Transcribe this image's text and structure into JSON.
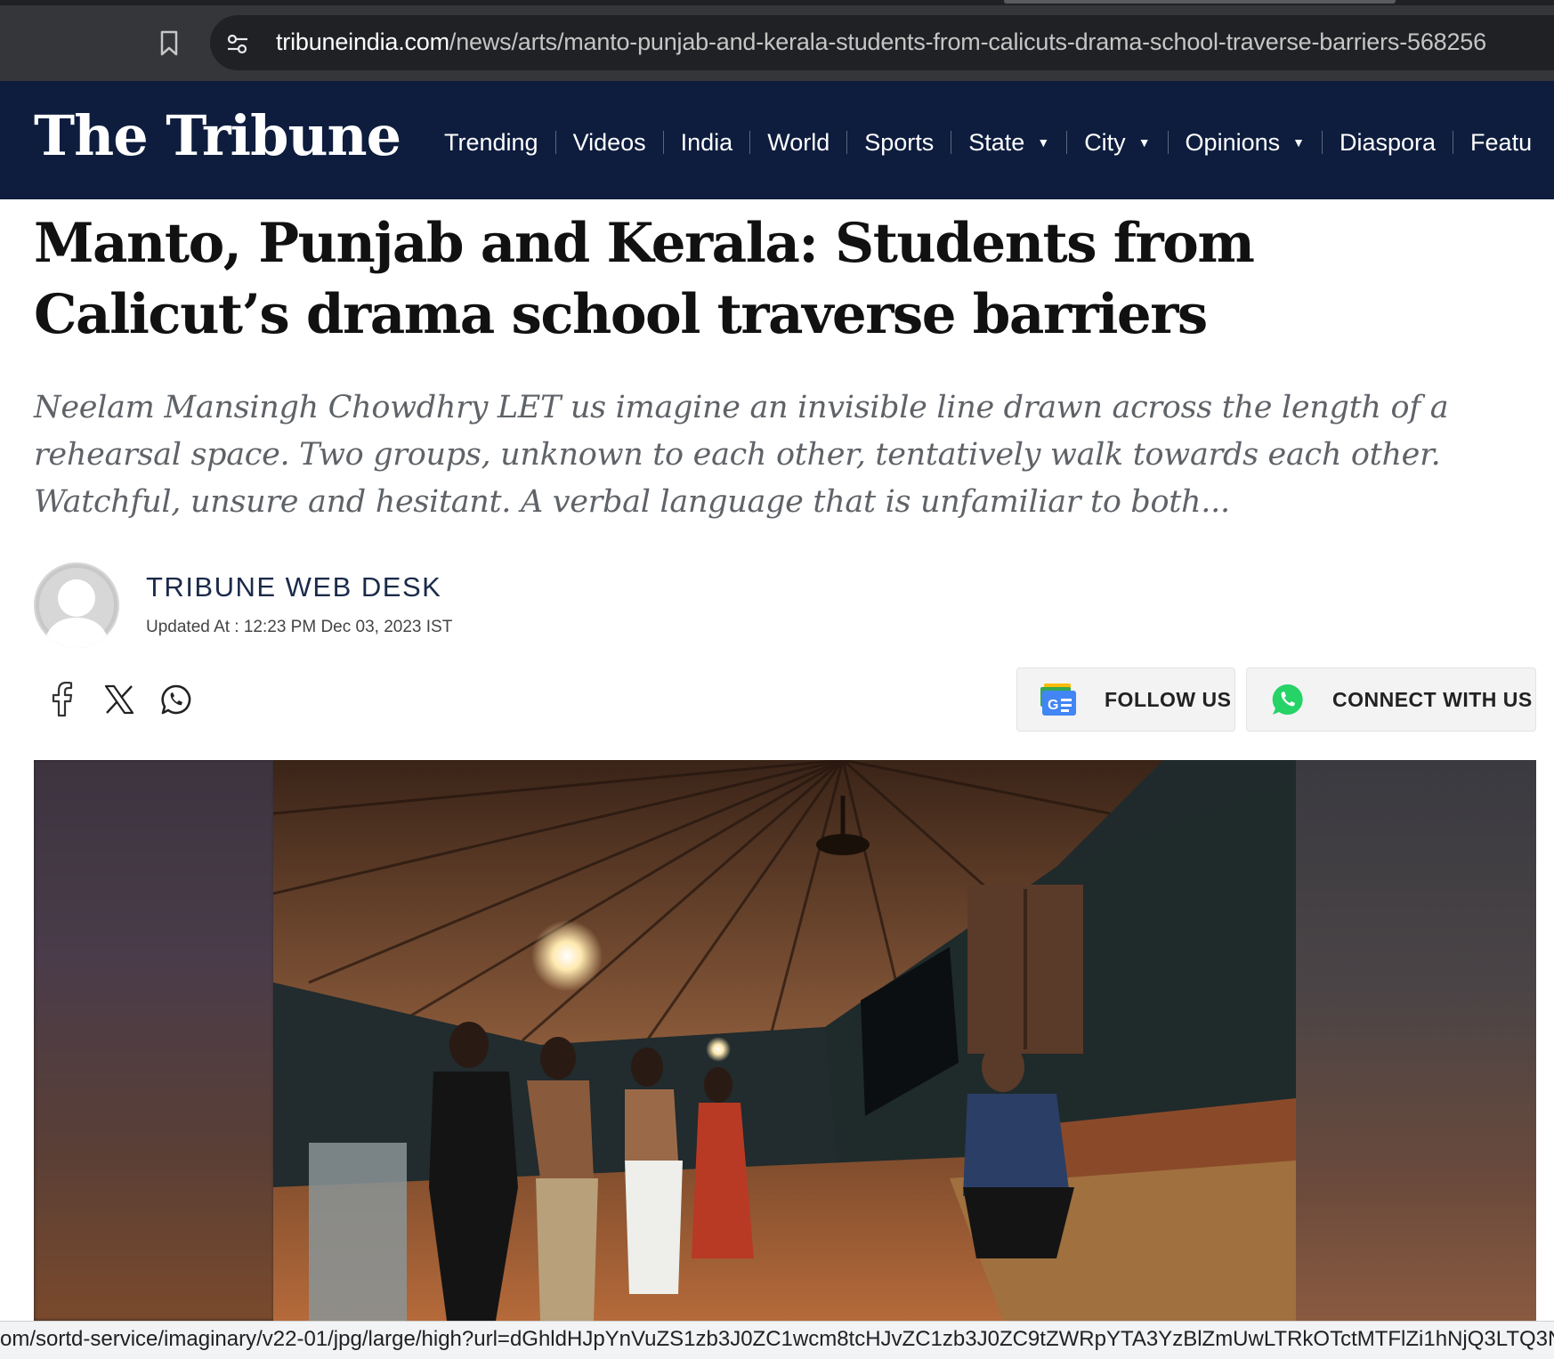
{
  "browser": {
    "url_host": "tribuneindia.com",
    "url_path": "/news/arts/manto-punjab-and-kerala-students-from-calicuts-drama-school-traverse-barriers-568256",
    "status_url": "om/sortd-service/imaginary/v22-01/jpg/large/high?url=dGhldHJpYnVuZS1zb3J0ZC1wcm8tcHJvZC1zb3J0ZC9tZWRpYTA3YzBlZmUwLTRkOTctMTFlZi1hNjQ3LTQ3NDlINWIw"
  },
  "header": {
    "logo": "The Tribune",
    "nav": [
      {
        "label": "Trending",
        "caret": false
      },
      {
        "label": "Videos",
        "caret": false
      },
      {
        "label": "India",
        "caret": false
      },
      {
        "label": "World",
        "caret": false
      },
      {
        "label": "Sports",
        "caret": false
      },
      {
        "label": "State",
        "caret": true
      },
      {
        "label": "City",
        "caret": true
      },
      {
        "label": "Opinions",
        "caret": true
      },
      {
        "label": "Diaspora",
        "caret": false
      },
      {
        "label": "Featu",
        "caret": false
      }
    ]
  },
  "article": {
    "headline": "Manto, Punjab and Kerala: Students from Calicut’s drama school traverse barriers",
    "dek": "Neelam Mansingh Chowdhry LET us imagine an invisible line drawn across the length of a rehearsal space. Two groups, unknown to each other, tentatively walk towards each other. Watchful, unsure and hesitant. A verbal language that is unfamiliar to both...",
    "author": "TRIBUNE WEB DESK",
    "updated": "Updated At : 12:23 PM Dec 03, 2023 IST"
  },
  "actions": {
    "follow_label": "FOLLOW US",
    "connect_label": "CONNECT WITH US",
    "share_icons": [
      "facebook-icon",
      "x-icon",
      "whatsapp-icon"
    ]
  },
  "colors": {
    "header_bg": "#0e1d3e",
    "whatsapp": "#25d366"
  }
}
